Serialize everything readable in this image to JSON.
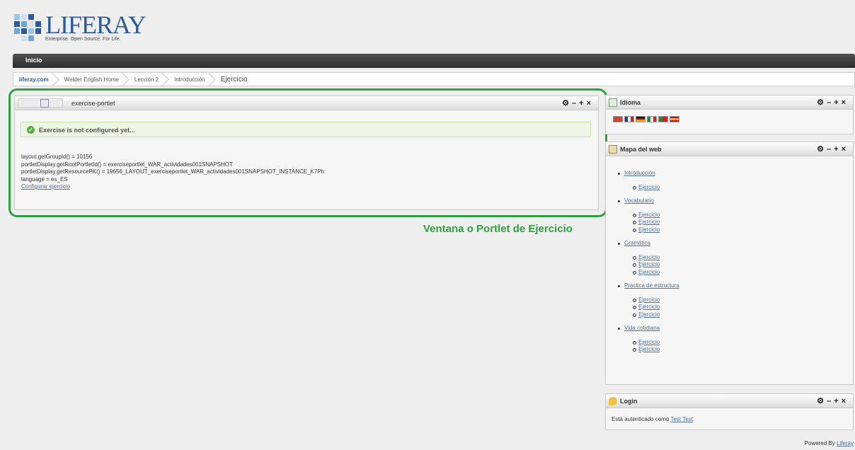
{
  "logo": {
    "word": "LIFERAY",
    "tagline": "Enterprise. Open Source. For Life."
  },
  "nav": {
    "home": "Inicio"
  },
  "breadcrumb": [
    "liferay.com",
    "Welder English Home",
    "Lección 2",
    "Introducción",
    "Ejercicio"
  ],
  "exercise_portlet": {
    "title": "exercise-portlet",
    "message": "Exercise is not configured yet...",
    "lines": [
      "layout.getGroupId() = 10156",
      "portletDisplay.getRootPortletId() = exerciseportlet_WAR_actividades001SNAPSHOT",
      "portletDisplay.getResourcePK() = 19656_LAYOUT_exerciseportlet_WAR_actividades001SNAPSHOT_INSTANCE_K7Ph",
      "language = es_ES"
    ],
    "config_link": "Configurar ejercicio"
  },
  "annotation": "Ventana o Portlet de Ejercicio",
  "idioma": {
    "title": "Idioma",
    "flags": [
      "uk-flag",
      "fr-flag",
      "de-flag",
      "it-flag",
      "pt-flag",
      "es-flag"
    ]
  },
  "sitemap": {
    "title": "Mapa del web",
    "items": [
      {
        "label": "Introducción",
        "children": [
          "Ejercicio"
        ]
      },
      {
        "label": "Vocabulario",
        "children": [
          "Ejercicio",
          "Ejercicio",
          "Ejercicio"
        ]
      },
      {
        "label": "Gramática",
        "children": [
          "Ejercicio",
          "Ejercicio",
          "Ejercicio"
        ]
      },
      {
        "label": "Práctica de estructura",
        "children": [
          "Ejercicio",
          "Ejercicio",
          "Ejercicio"
        ]
      },
      {
        "label": "Vida cotidiana",
        "children": [
          "Ejercicio",
          "Ejercicio"
        ]
      }
    ]
  },
  "login": {
    "title": "Login",
    "text": "Está autenticado como ",
    "user": "Test Test",
    "period": "."
  },
  "footer": {
    "powered_by": "Powered By ",
    "powered_link": "Liferay"
  },
  "colors": {
    "accent_green": "#2ba33f",
    "nav_dark": "#3a3a3a",
    "link": "#4c6f9e"
  }
}
